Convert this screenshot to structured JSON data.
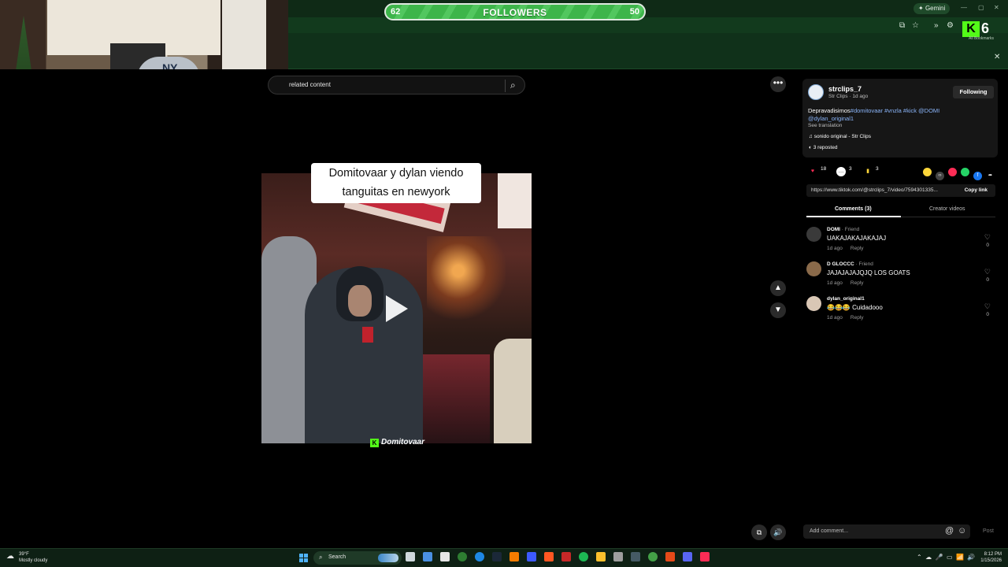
{
  "browser": {
    "gemini_label": "Gemini",
    "bookmarks_label": "All Bookmarks",
    "kick_count": "6"
  },
  "followers_bar": {
    "label": "FOLLOWERS",
    "current": "62",
    "goal": "50"
  },
  "search": {
    "text": "related content"
  },
  "video": {
    "caption_line1": "Domitovaar y dylan viendo",
    "caption_line2": "tanguitas en newyork",
    "watermark": "Domitovaar",
    "watermark_logo": "K"
  },
  "post": {
    "username": "strclips_7",
    "subline": "Str Clips · 1d ago",
    "follow_label": "Following",
    "description_plain": "Depravadisimos",
    "description_tags": "#domitovaar #vnzla #kick @DOMI",
    "description_mention": "@dylan_original1",
    "see_translation": "See translation",
    "sound": "sonido original - Str Clips",
    "reposted": "3 reposted",
    "likes": "18",
    "comments": "3",
    "saves": "3",
    "link": "https://www.tiktok.com/@strclips_7/video/7594301335...",
    "copy_label": "Copy link"
  },
  "tabs": {
    "comments": "Comments (3)",
    "creator": "Creator videos"
  },
  "comments_list": [
    {
      "name": "DOMI",
      "friend": " · Friend",
      "text": "UAKAJAKAJAKAJAJ",
      "time": "1d ago",
      "reply": "Reply",
      "likes": "0",
      "color": "#3a3a3a"
    },
    {
      "name": "D GLOCCC",
      "friend": " · Friend",
      "text": "JAJAJAJAJQJQ LOS GOATS",
      "time": "1d ago",
      "reply": "Reply",
      "likes": "0",
      "color": "#8a6a4a"
    },
    {
      "name": "dylan_original1",
      "friend": "",
      "text": "😂😂😂 Cuidadooo",
      "time": "1d ago",
      "reply": "Reply",
      "likes": "0",
      "color": "#d9c7b5"
    }
  ],
  "composer": {
    "placeholder": "Add comment...",
    "post_label": "Post"
  },
  "taskbar": {
    "temp": "39°F",
    "weather": "Mostly cloudy",
    "search_label": "Search",
    "time": "8:12 PM",
    "date": "1/15/2026"
  },
  "colors": {
    "kick_green": "#53fc18",
    "followers_green": "#3db54a",
    "tag_blue": "#8ab4f8"
  }
}
